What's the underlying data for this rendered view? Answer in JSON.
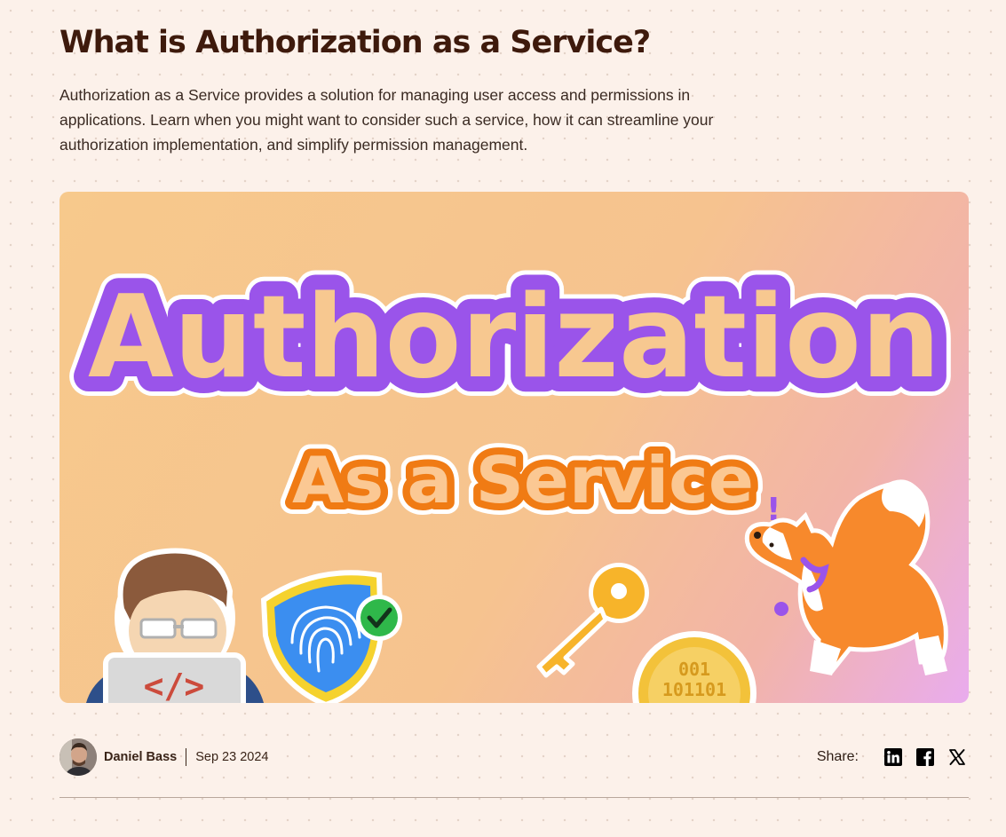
{
  "article": {
    "title": "What is Authorization as a Service?",
    "description": "Authorization as a Service provides a solution for managing user access and permissions in applications. Learn when you might want to consider such a service, how it can streamline your authorization implementation, and simplify permission management."
  },
  "hero": {
    "headline": "Authorization",
    "subheadline": "As a Service",
    "code_symbol": "</>",
    "coin_text_1": "001",
    "coin_text_2": "101101",
    "exclamation": "!",
    "colors": {
      "headline_fill": "#f7c890",
      "headline_stroke": "#9a54ea",
      "subheadline_fill": "#fbc893",
      "subheadline_stroke": "#f07b14"
    }
  },
  "meta": {
    "author": "Daniel Bass",
    "date": "Sep 23 2024"
  },
  "share": {
    "label": "Share:",
    "icons": [
      "linkedin-icon",
      "facebook-icon",
      "x-icon"
    ]
  }
}
